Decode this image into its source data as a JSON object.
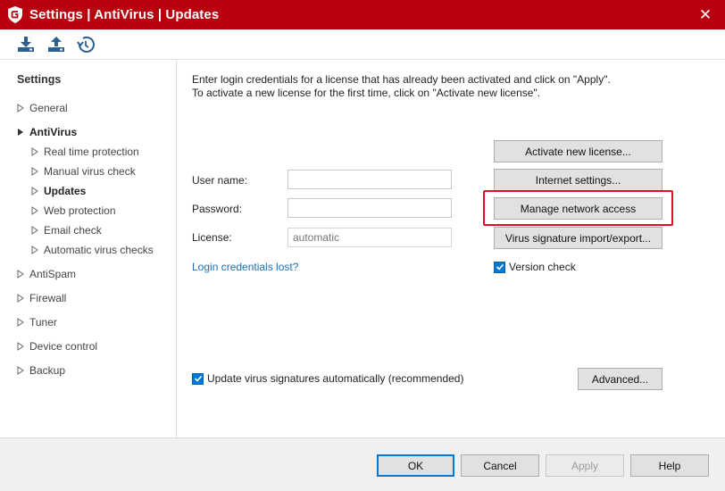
{
  "window": {
    "title": "Settings | AntiVirus | Updates",
    "close_label": "✕"
  },
  "toolbar": {
    "icons": [
      "download-icon",
      "upload-icon",
      "restore-icon"
    ]
  },
  "sidebar": {
    "heading": "Settings",
    "items": [
      {
        "label": "General",
        "expanded": false
      },
      {
        "label": "AntiVirus",
        "expanded": true
      },
      {
        "label": "Real time protection"
      },
      {
        "label": "Manual virus check"
      },
      {
        "label": "Updates",
        "selected": true
      },
      {
        "label": "Web protection"
      },
      {
        "label": "Email check"
      },
      {
        "label": "Automatic virus checks"
      },
      {
        "label": "AntiSpam",
        "expanded": false
      },
      {
        "label": "Firewall",
        "expanded": false
      },
      {
        "label": "Tuner",
        "expanded": false
      },
      {
        "label": "Device control",
        "expanded": false
      },
      {
        "label": "Backup",
        "expanded": false
      }
    ]
  },
  "main": {
    "intro_line1": "Enter login credentials for a license that has already been activated and click on \"Apply\".",
    "intro_line2": "To activate a new license for the first time, click on \"Activate new license\".",
    "username_label": "User name:",
    "username_value": "",
    "password_label": "Password:",
    "password_value": "",
    "license_label": "License:",
    "license_value": "automatic",
    "lost_link": "Login credentials lost?",
    "buttons": {
      "activate": "Activate new license...",
      "internet": "Internet settings...",
      "manage": "Manage network access",
      "signature": "Virus signature import/export...",
      "advanced": "Advanced..."
    },
    "version_check_label": "Version check",
    "version_check_checked": true,
    "auto_update_label": "Update virus signatures automatically (recommended)",
    "auto_update_checked": true
  },
  "footer": {
    "ok": "OK",
    "cancel": "Cancel",
    "apply": "Apply",
    "help": "Help"
  },
  "colors": {
    "titlebar": "#b8000e",
    "accent": "#0078d7",
    "link": "#1a6fb5",
    "highlight": "#e0102a"
  }
}
